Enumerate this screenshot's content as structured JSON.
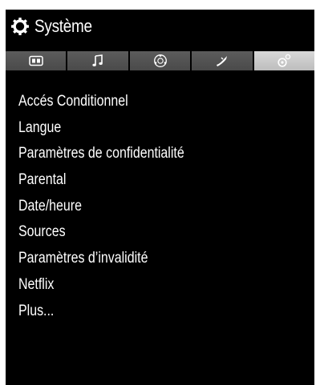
{
  "header": {
    "title": "Système",
    "icon": "gear-icon"
  },
  "tabs": [
    {
      "icon": "picture-icon",
      "active": false
    },
    {
      "icon": "music-note-icon",
      "active": false
    },
    {
      "icon": "globe-network-icon",
      "active": false
    },
    {
      "icon": "satellite-dish-icon",
      "active": false
    },
    {
      "icon": "settings-gear-icon",
      "active": true
    }
  ],
  "menu": {
    "items": [
      {
        "label": "Accés Conditionnel"
      },
      {
        "label": "Langue"
      },
      {
        "label": "Paramètres de confidentialité"
      },
      {
        "label": "Parental"
      },
      {
        "label": "Date/heure"
      },
      {
        "label": "Sources"
      },
      {
        "label": "Paramètres d’invalidité"
      },
      {
        "label": "Netflix"
      },
      {
        "label": "Plus..."
      }
    ]
  },
  "colors": {
    "panel_background": "#000000",
    "text": "#ffffff",
    "tab_inactive": "#555555",
    "tab_active": "#cccccc"
  }
}
